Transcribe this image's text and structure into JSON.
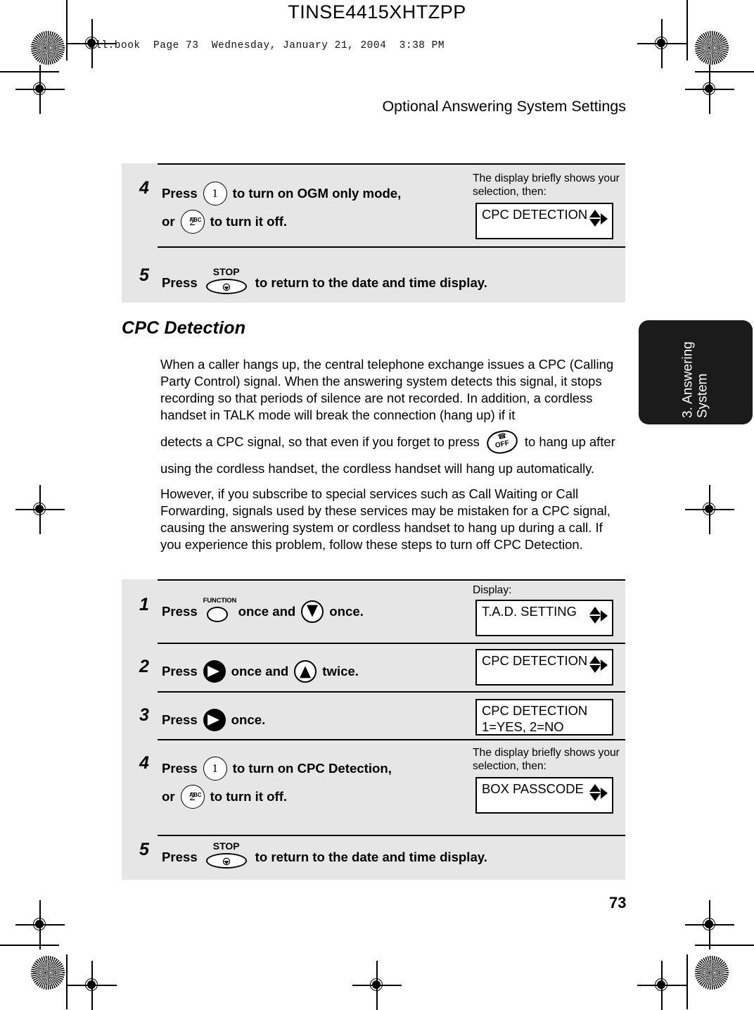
{
  "print_marks": {
    "doc_code": "TINSE4415XHTZPP",
    "file_stamp": "all.book  Page 73  Wednesday, January 21, 2004  3:38 PM"
  },
  "header": {
    "running_head": "Optional Answering System Settings"
  },
  "thumb_tab": {
    "label": "3. Answering\nSystem"
  },
  "footer": {
    "page_number": "73"
  },
  "section": {
    "heading": "CPC Detection",
    "paragraphs": [
      "When a caller hangs up, the central telephone exchange issues a CPC (Calling Party Control) signal. When the answering system detects this signal, it stops recording so that periods of silence are not recorded. In addition, a cordless handset in TALK mode will break the connection (hang up) if it",
      "detects a CPC signal, so that even if you forget to press",
      "to hang up after",
      "using the cordless handset, the cordless handset will hang up automatically.",
      "However, if you subscribe to special services such as Call Waiting or Call Forwarding, signals used by these services may be mistaken for a CPC signal, causing the answering system or cordless handset to hang up during a call. If you experience this problem, follow these steps to turn off CPC Detection."
    ]
  },
  "keys": {
    "one": "1",
    "two": "2",
    "two_sub": "ABC",
    "function": "FUNCTION",
    "stop": "STOP",
    "off": "OFF"
  },
  "procedure_top": {
    "steps": [
      {
        "number": "4",
        "line1_a": "Press",
        "line1_b": "to turn on OGM only mode,",
        "line2_a": "or",
        "line2_b": "to turn it off.",
        "note": "The display briefly shows your selection, then:",
        "display_line1": "CPC DETECTION",
        "display_line2": ""
      },
      {
        "number": "5",
        "line1_a": "Press",
        "line1_b": "to return to the date and time display."
      }
    ]
  },
  "procedure_bottom": {
    "display_label": "Display:",
    "steps": [
      {
        "number": "1",
        "line1_a": "Press",
        "line1_b": "once and",
        "line1_c": "once.",
        "display_line1": "T.A.D. SETTING",
        "display_line2": ""
      },
      {
        "number": "2",
        "line1_a": "Press",
        "line1_b": "once and",
        "line1_c": "twice.",
        "display_line1": "CPC DETECTION",
        "display_line2": ""
      },
      {
        "number": "3",
        "line1_a": "Press",
        "line1_b": "once.",
        "display_line1": "CPC DETECTION",
        "display_line2": "1=YES, 2=NO"
      },
      {
        "number": "4",
        "line1_a": "Press",
        "line1_b": "to turn on CPC Detection,",
        "line2_a": "or",
        "line2_b": "to turn it off.",
        "note": "The display briefly shows your selection, then:",
        "display_line1": "BOX PASSCODE",
        "display_line2": ""
      },
      {
        "number": "5",
        "line1_a": "Press",
        "line1_b": "to return to the date and time display."
      }
    ]
  }
}
